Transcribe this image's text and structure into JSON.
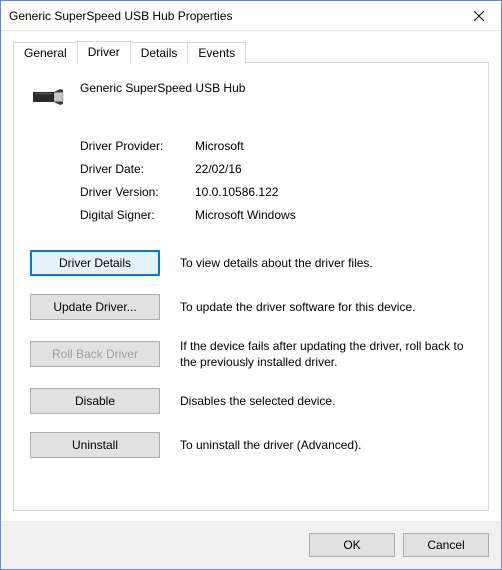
{
  "window": {
    "title": "Generic SuperSpeed USB Hub Properties"
  },
  "tabs": {
    "general": "General",
    "driver": "Driver",
    "details": "Details",
    "events": "Events",
    "active": "driver"
  },
  "device": {
    "name": "Generic SuperSpeed USB Hub"
  },
  "info": {
    "provider_label": "Driver Provider:",
    "provider_value": "Microsoft",
    "date_label": "Driver Date:",
    "date_value": "22/02/16",
    "version_label": "Driver Version:",
    "version_value": "10.0.10586.122",
    "signer_label": "Digital Signer:",
    "signer_value": "Microsoft Windows"
  },
  "actions": {
    "details": {
      "label": "Driver Details",
      "desc": "To view details about the driver files."
    },
    "update": {
      "label": "Update Driver...",
      "desc": "To update the driver software for this device."
    },
    "rollback": {
      "label": "Roll Back Driver",
      "desc": "If the device fails after updating the driver, roll back to the previously installed driver."
    },
    "disable": {
      "label": "Disable",
      "desc": "Disables the selected device."
    },
    "uninstall": {
      "label": "Uninstall",
      "desc": "To uninstall the driver (Advanced)."
    }
  },
  "footer": {
    "ok": "OK",
    "cancel": "Cancel"
  }
}
